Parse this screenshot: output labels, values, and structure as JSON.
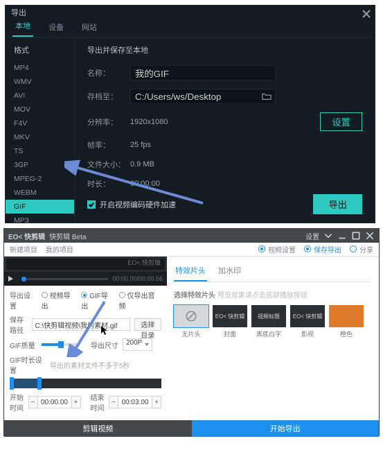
{
  "dlg": {
    "title": "导出",
    "tabs": [
      "本地",
      "设备",
      "网站"
    ],
    "active_tab": 0,
    "side_header": "格式",
    "formats": [
      "MP4",
      "WMV",
      "AVI",
      "MOV",
      "F4V",
      "MKV",
      "TS",
      "3GP",
      "MPEG-2",
      "WEBM",
      "GIF",
      "MP3"
    ],
    "active_format": "GIF",
    "main_title": "导出并保存至本地",
    "fields": {
      "name_label": "名称：",
      "name_value": "我的GIF",
      "path_label": "存档至：",
      "path_value": "C:/Users/ws/Desktop",
      "res_label": "分辨率：",
      "res_value": "1920x1080",
      "res_btn": "设置",
      "fps_label": "帧率：",
      "fps_value": "25 fps",
      "size_label": "文件大小：",
      "size_value": "0.9 MB",
      "dur_label": "时长：",
      "dur_value": "00:00:00"
    },
    "hw_accel": "开启视频编码硬件加速",
    "export_btn": "导出"
  },
  "app": {
    "title": "快剪辑 Beta",
    "title_icon": "EO< 快剪辑",
    "toolbar": {
      "new": "新建项目",
      "my": "我的项目",
      "step1": "视频设置",
      "step2": "保存导出",
      "step3": "分享"
    },
    "settings_icon": "设置",
    "preview_logo": "EO< 快剪辑",
    "time": "00:00.00/00:00.56",
    "left_form": {
      "export_set_label": "导出设置",
      "rad1": "视频导出",
      "rad2": "GIF导出",
      "rad3": "仅导出音频",
      "save_to_label": "保存路径",
      "save_to_value": "C:\\快剪辑视频\\我的素材.gif",
      "browse": "选择目录",
      "quality_label": "GIF质量",
      "size_label": "导出尺寸",
      "size_value": "200P",
      "trim_label": "GIF时长设置",
      "trim_hint": "导出的素材文件不多于5秒",
      "start_label": "开始时间",
      "start_value": "00:00.00",
      "end_label": "结束时间",
      "end_value": "00:03.00"
    },
    "right": {
      "tab1": "特效片头",
      "tab2": "加水印",
      "subtitle": "选择特效片头",
      "subtitle_hint": "预览效果请点击底部播放按钮",
      "thumbs": [
        {
          "label": "无片头",
          "box_text": ""
        },
        {
          "label": "封面",
          "box_text": "EO< 快剪辑"
        },
        {
          "label": "黑底白字",
          "box_text": "视频标题"
        },
        {
          "label": "影视",
          "box_text": "EO< 快剪辑"
        },
        {
          "label": "橙色",
          "box_text": ""
        }
      ]
    },
    "bottom": {
      "edit": "剪辑视频",
      "go": "开始导出"
    }
  }
}
